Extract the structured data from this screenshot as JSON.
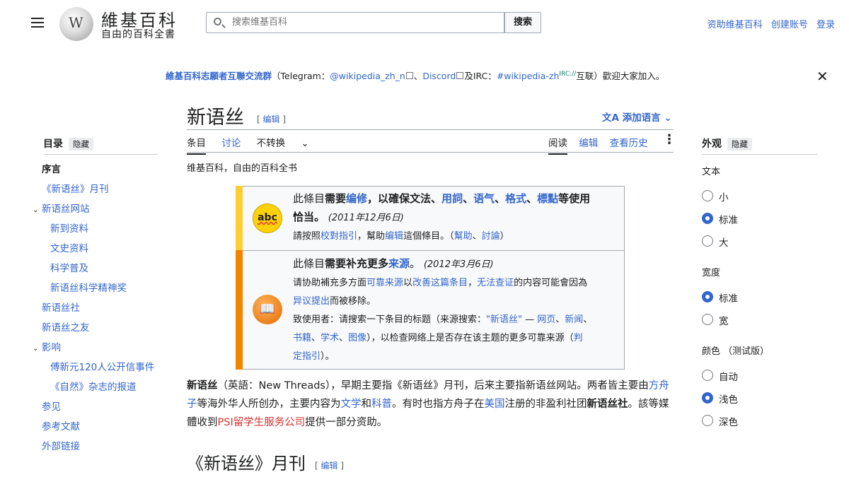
{
  "header": {
    "logo_title": "維基百科",
    "logo_subtitle": "自由的百科全書",
    "logo_glyph": "W",
    "search_placeholder": "搜索维基百科",
    "search_button": "搜索",
    "user_links": [
      "资助维基百科",
      "创建账号",
      "登录"
    ]
  },
  "banner": {
    "group": "維基百科志願者互聯交流群",
    "open": "（Telegram：",
    "telegram": "@wikipedia_zh_n",
    "sep1": "、",
    "discord": "Discord",
    "and": "及IRC：",
    "irc_channel": "#wikipedia-zh",
    "irc_sup": "IRC://",
    "tail": "互联）歡迎大家加入。",
    "close": "✕"
  },
  "page": {
    "title": "新语丝",
    "edit": "编辑",
    "add_languages": "添加语言",
    "tabs_left": [
      "条目",
      "讨论",
      "不转换"
    ],
    "tabs_right": [
      "阅读",
      "编辑",
      "查看历史"
    ],
    "subtitle": "维基百科，自由的百科全书"
  },
  "toc": {
    "heading": "目录",
    "hide": "隐藏",
    "items": [
      {
        "label": "序言",
        "level": 0
      },
      {
        "label": "《新语丝》月刊",
        "level": 0
      },
      {
        "label": "新语丝网站",
        "level": 0,
        "chevron": true
      },
      {
        "label": "新到资料",
        "level": 1
      },
      {
        "label": "文史资料",
        "level": 1
      },
      {
        "label": "科学普及",
        "level": 1
      },
      {
        "label": "新语丝科学精神奖",
        "level": 1
      },
      {
        "label": "新语丝社",
        "level": 0
      },
      {
        "label": "新语丝之友",
        "level": 0
      },
      {
        "label": "影响",
        "level": 0,
        "chevron": true
      },
      {
        "label": "傅新元120人公开信事件",
        "level": 1
      },
      {
        "label": "《自然》杂志的报道",
        "level": 1
      },
      {
        "label": "参见",
        "level": 0
      },
      {
        "label": "参考文献",
        "level": 0
      },
      {
        "label": "外部链接",
        "level": 0
      }
    ]
  },
  "appearance": {
    "heading": "外观",
    "hide": "隐藏",
    "text_label": "文本",
    "text_options": [
      "小",
      "标准",
      "大"
    ],
    "text_selected": 1,
    "width_label": "宽度",
    "width_options": [
      "标准",
      "宽"
    ],
    "width_selected": 0,
    "color_label": "颜色 （测试版）",
    "color_options": [
      "自动",
      "浅色",
      "深色"
    ],
    "color_selected": 1
  },
  "ambox1": {
    "l1a": "此條目",
    "l1b": "需要",
    "l1c": "编修",
    "l1d": "，以確保文法、",
    "l1e": "用詞",
    "l1f": "、",
    "l1g": "语气",
    "l1h": "、",
    "l1i": "格式",
    "l1j": "、",
    "l1k": "標點",
    "l1l": "等使用",
    "l2": "恰当。",
    "date": "(2011年12月6日)",
    "l3a": "請按照",
    "l3b": "校對指引",
    "l3c": "，幫助",
    "l3d": "编辑",
    "l3e": "這個條目。（",
    "l3f": "幫助",
    "l3g": "、",
    "l3h": "討論",
    "l3i": "）"
  },
  "ambox2": {
    "l1a": "此條目",
    "l1b": "需要补充更多",
    "l1c": "来源",
    "l1d": "。",
    "date": "(2012年3月6日)",
    "l2a": "请协助補充多方面",
    "l2b": "可靠来源",
    "l2c": "以",
    "l2d": "改善这篇条目",
    "l2e": "，",
    "l2f": "无法查证",
    "l2g": "的内容可能會因為",
    "l3a": "异议提出",
    "l3b": "而被移除。",
    "l4a": "致使用者：请搜索一下条目的标题（来源搜索：",
    "l4b": "\"新语丝\"",
    "l4c": " — ",
    "l4d": "网页",
    "l4e": "、",
    "l4f": "新闻",
    "l4g": "、",
    "l5a": "书籍",
    "l5b": "、",
    "l5c": "学术",
    "l5d": "、",
    "l5e": "图像",
    "l5f": "），以检查网络上是否存在该主题的更多可靠来源（",
    "l5g": "判",
    "l6a": "定指引",
    "l6b": "）。"
  },
  "lead": {
    "a": "新语丝",
    "b": "（英語：New Threads），早期主要指《新语丝》月刊，后来主要指新语丝网站。两者皆主",
    "c": "要由",
    "d": "方舟子",
    "e": "等海外华人所创办，主要内容为",
    "f": "文学",
    "g": "和",
    "h": "科普",
    "i": "。有时也指方舟子在",
    "j": "美国",
    "k": "注册的非盈利社团",
    "l": "新语丝社",
    "m": "。該等媒體收到",
    "n": "PSI留学生服务公司",
    "o": "提供一部分资助。"
  },
  "section": {
    "title": "《新语丝》月刊",
    "edit": "编辑"
  }
}
